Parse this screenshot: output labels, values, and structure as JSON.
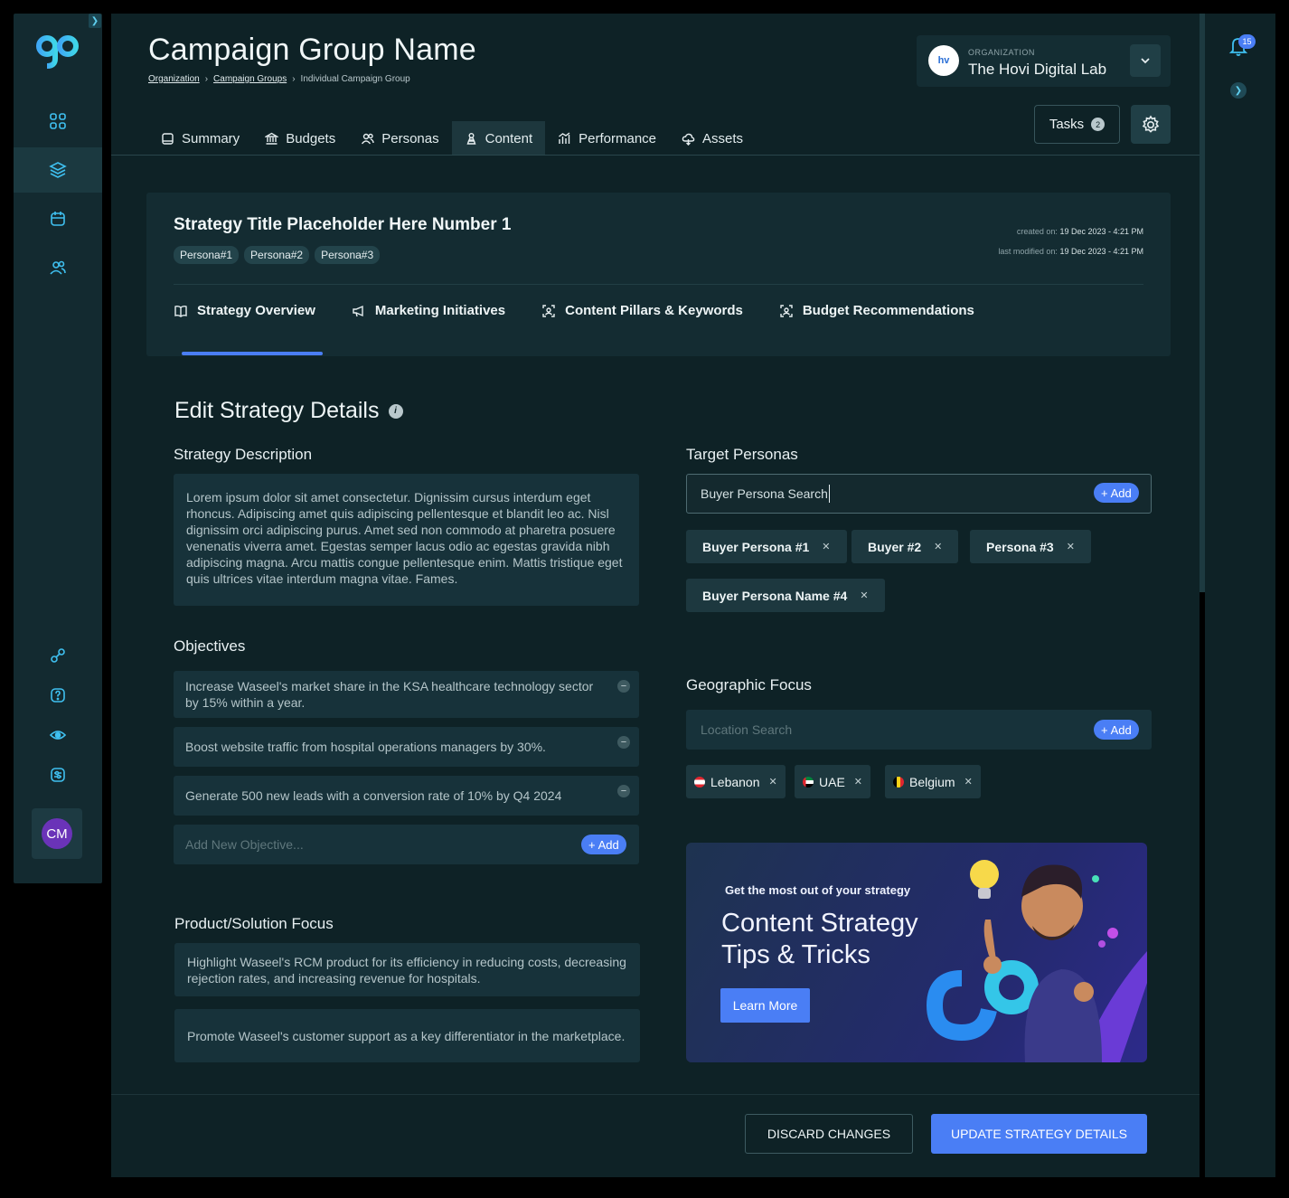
{
  "app": {
    "avatar_initials": "CM",
    "accent": "#4a7ef5",
    "brand": "#3fc0f0"
  },
  "header": {
    "title": "Campaign Group Name",
    "breadcrumb": [
      "Organization",
      "Campaign Groups",
      "Individual Campaign Group"
    ],
    "organization": {
      "label": "ORGANIZATION",
      "name": "The Hovi Digital Lab",
      "logo_text": "hv"
    },
    "tasks_label": "Tasks",
    "tasks_count": "2",
    "notification_count": "15"
  },
  "tabs": [
    {
      "label": "Summary",
      "icon": "book-icon"
    },
    {
      "label": "Budgets",
      "icon": "bank-icon"
    },
    {
      "label": "Personas",
      "icon": "users-icon"
    },
    {
      "label": "Content",
      "icon": "chess-pawn-icon",
      "active": true
    },
    {
      "label": "Performance",
      "icon": "chart-icon"
    },
    {
      "label": "Assets",
      "icon": "cloud-icon"
    }
  ],
  "strategy": {
    "title": "Strategy Title Placeholder Here Number 1",
    "personas": [
      "Persona#1",
      "Persona#2",
      "Persona#3"
    ],
    "created_label": "created on:",
    "created": "19 Dec 2023 - 4:21 PM",
    "modified_label": "last modified on:",
    "modified": "19 Dec 2023 - 4:21 PM",
    "subtabs": [
      "Strategy Overview",
      "Marketing Initiatives",
      "Content Pillars & Keywords",
      "Budget Recommendations"
    ]
  },
  "form": {
    "section_title": "Edit Strategy Details",
    "description_label": "Strategy Description",
    "description": "Lorem ipsum dolor sit amet consectetur. Dignissim cursus interdum eget rhoncus. Adipiscing amet quis adipiscing pellentesque et blandit leo ac. Nisl dignissim orci adipiscing purus. Amet sed non commodo at pharetra posuere venenatis viverra amet. Egestas semper lacus odio ac egestas gravida nibh adipiscing magna. Arcu mattis congue pellentesque enim. Mattis tristique eget quis ultrices vitae interdum magna vitae. Fames.",
    "objectives_label": "Objectives",
    "objectives": [
      "Increase Waseel's market share in the KSA healthcare technology sector by 15% within a year.",
      "Boost website traffic from hospital operations managers by 30%.",
      "Generate 500 new leads with a conversion rate of 10% by Q4 2024"
    ],
    "objective_placeholder": "Add New Objective...",
    "add_label": "Add",
    "product_label": "Product/Solution Focus",
    "products": [
      "Highlight Waseel's RCM product for its efficiency in reducing costs, decreasing rejection rates, and increasing revenue for hospitals.",
      "Promote Waseel's customer support as a key differentiator in the marketplace."
    ],
    "personas_label": "Target Personas",
    "persona_search_value": "Buyer Persona Search",
    "target_personas": [
      "Buyer Persona #1",
      "Buyer #2",
      "Persona #3",
      "Buyer Persona Name #4"
    ],
    "geo_label": "Geographic Focus",
    "geo_placeholder": "Location Search",
    "locations": [
      {
        "name": "Lebanon",
        "flag_colors": [
          "#e0262f",
          "#ffffff"
        ]
      },
      {
        "name": "UAE",
        "flag_colors": [
          "#00843d",
          "#ffffff",
          "#000000",
          "#e0262f"
        ]
      },
      {
        "name": "Belgium",
        "flag_colors": [
          "#000000",
          "#f7d117",
          "#e0262f"
        ]
      }
    ]
  },
  "promo": {
    "subtitle": "Get the most out of your strategy",
    "title": "Content Strategy Tips & Tricks",
    "button": "Learn More"
  },
  "footer": {
    "discard": "DISCARD CHANGES",
    "update": "UPDATE STRATEGY DETAILS"
  }
}
